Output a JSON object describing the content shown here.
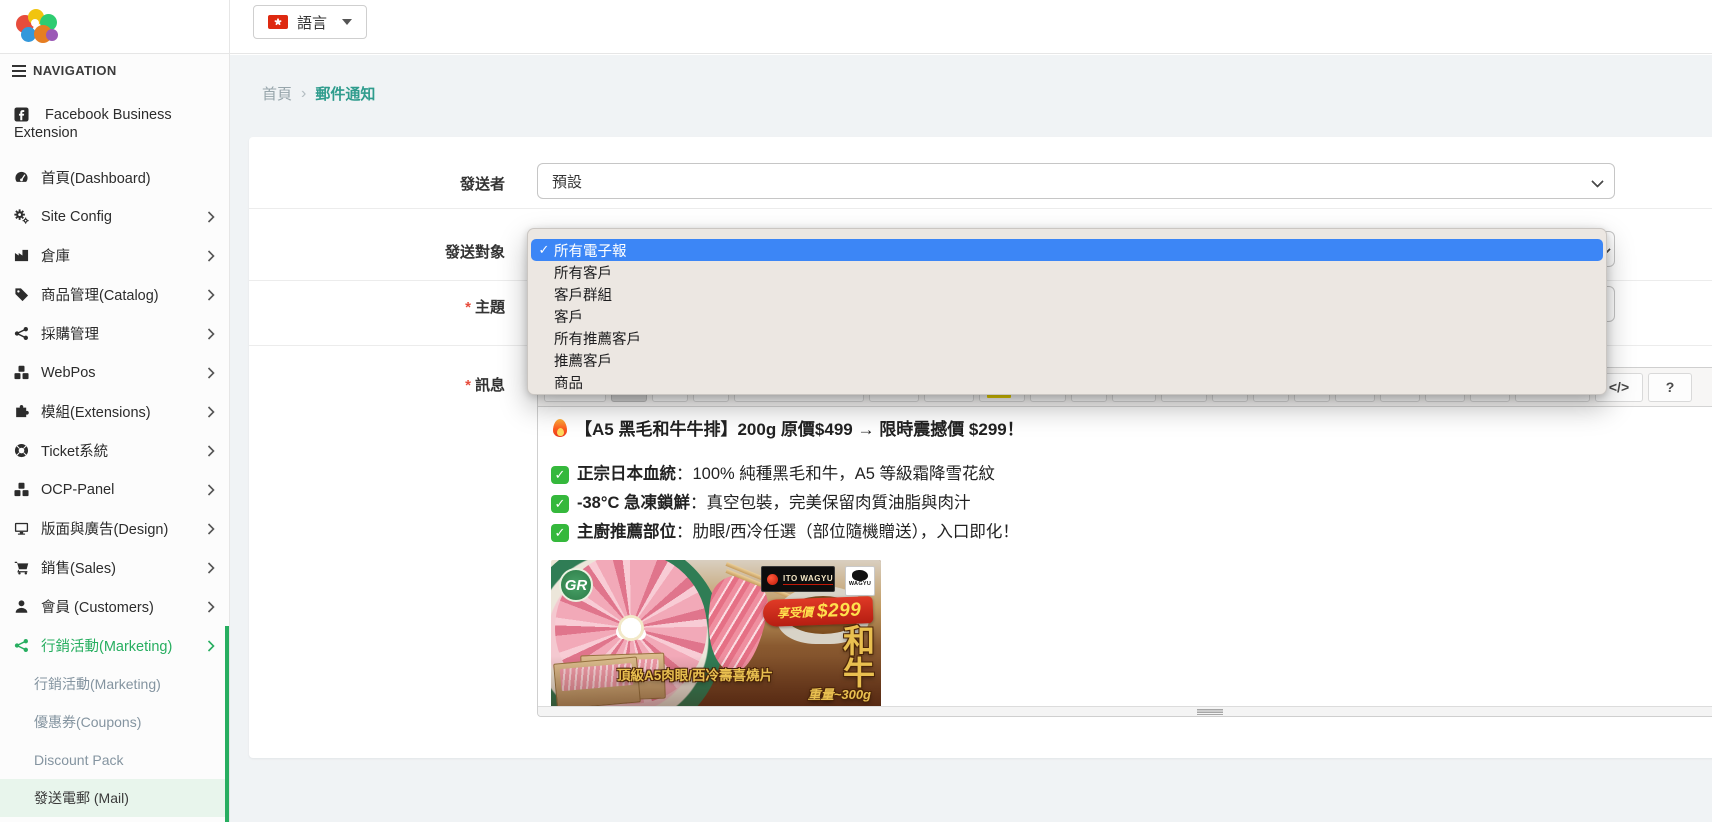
{
  "icons": {
    "check": "✓"
  },
  "topbar": {
    "language_label": "語言"
  },
  "sidebar": {
    "nav_header": "NAVIGATION",
    "items": [
      {
        "icon": "facebook",
        "label": "Facebook Business Extension"
      },
      {
        "icon": "dashboard",
        "label": "首頁(Dashboard)"
      },
      {
        "icon": "gears",
        "label": "Site Config",
        "has_children": true
      },
      {
        "icon": "warehouse",
        "label": "倉庫",
        "has_children": true
      },
      {
        "icon": "tag",
        "label": "商品管理(Catalog)",
        "has_children": true
      },
      {
        "icon": "share",
        "label": "採購管理",
        "has_children": true
      },
      {
        "icon": "cubes",
        "label": "WebPos",
        "has_children": true
      },
      {
        "icon": "puzzle",
        "label": "模組(Extensions)",
        "has_children": true
      },
      {
        "icon": "life-ring",
        "label": "Ticket系統",
        "has_children": true
      },
      {
        "icon": "cubes",
        "label": "OCP-Panel",
        "has_children": true
      },
      {
        "icon": "desktop",
        "label": "版面與廣告(Design)",
        "has_children": true
      },
      {
        "icon": "cart",
        "label": "銷售(Sales)",
        "has_children": true
      },
      {
        "icon": "user",
        "label": "會員 (Customers)",
        "has_children": true
      },
      {
        "icon": "share",
        "label": "行銷活動(Marketing)",
        "has_children": true,
        "active": true
      }
    ],
    "submenu": [
      {
        "label": "行銷活動(Marketing)"
      },
      {
        "label": "優惠券(Coupons)"
      },
      {
        "label": "Discount Pack"
      },
      {
        "label": "發送電郵 (Mail)",
        "active": true
      }
    ]
  },
  "breadcrumb": {
    "home": "首頁",
    "separator": "›",
    "current": "郵件通知"
  },
  "form": {
    "required_mark": "*",
    "sender_label": "發送者",
    "sender_value": "預設",
    "target_label": "發送對象",
    "subject_label": "主題",
    "subject_value": "",
    "message_label": "訊息"
  },
  "dropdown": {
    "selected_index": 0,
    "options": [
      "所有電子報",
      "所有客戶",
      "客戶群組",
      "客戶",
      "所有推薦客戶",
      "推薦客戶",
      "商品"
    ]
  },
  "editor": {
    "codeview_label": "</>",
    "help_label": "?",
    "content": {
      "headline": "【A5 黑毛和牛牛排】200g 原價$499 → 限時震撼價 $299！",
      "bullets": [
        {
          "bold": "正宗日本血統",
          "rest": "：100% 純種黑毛和牛，A5 等級霜降雪花紋"
        },
        {
          "bold": "-38°C 急凍鎖鮮",
          "rest": "：真空包裝，完美保留肉質油脂與肉汁"
        },
        {
          "bold": "主廚推薦部位",
          "rest": "：肋眼/西冷任選（部位隨機贈送），入口即化！"
        }
      ]
    },
    "banner": {
      "badge": "GR",
      "brand": "ITO WAGYU",
      "brand_side": "WAGYU",
      "price_prefix": "享受價",
      "price": "$299",
      "vertical_title": "和牛",
      "caption": "頂級A5肉眼/西冷壽喜燒片",
      "weight": "重量~300g"
    }
  },
  "colors": {
    "accent_green": "#27ae60",
    "breadcrumb_active": "#2f9c8d",
    "selection_blue": "#3c86f6",
    "highlight_yellow": "#e7d000"
  }
}
